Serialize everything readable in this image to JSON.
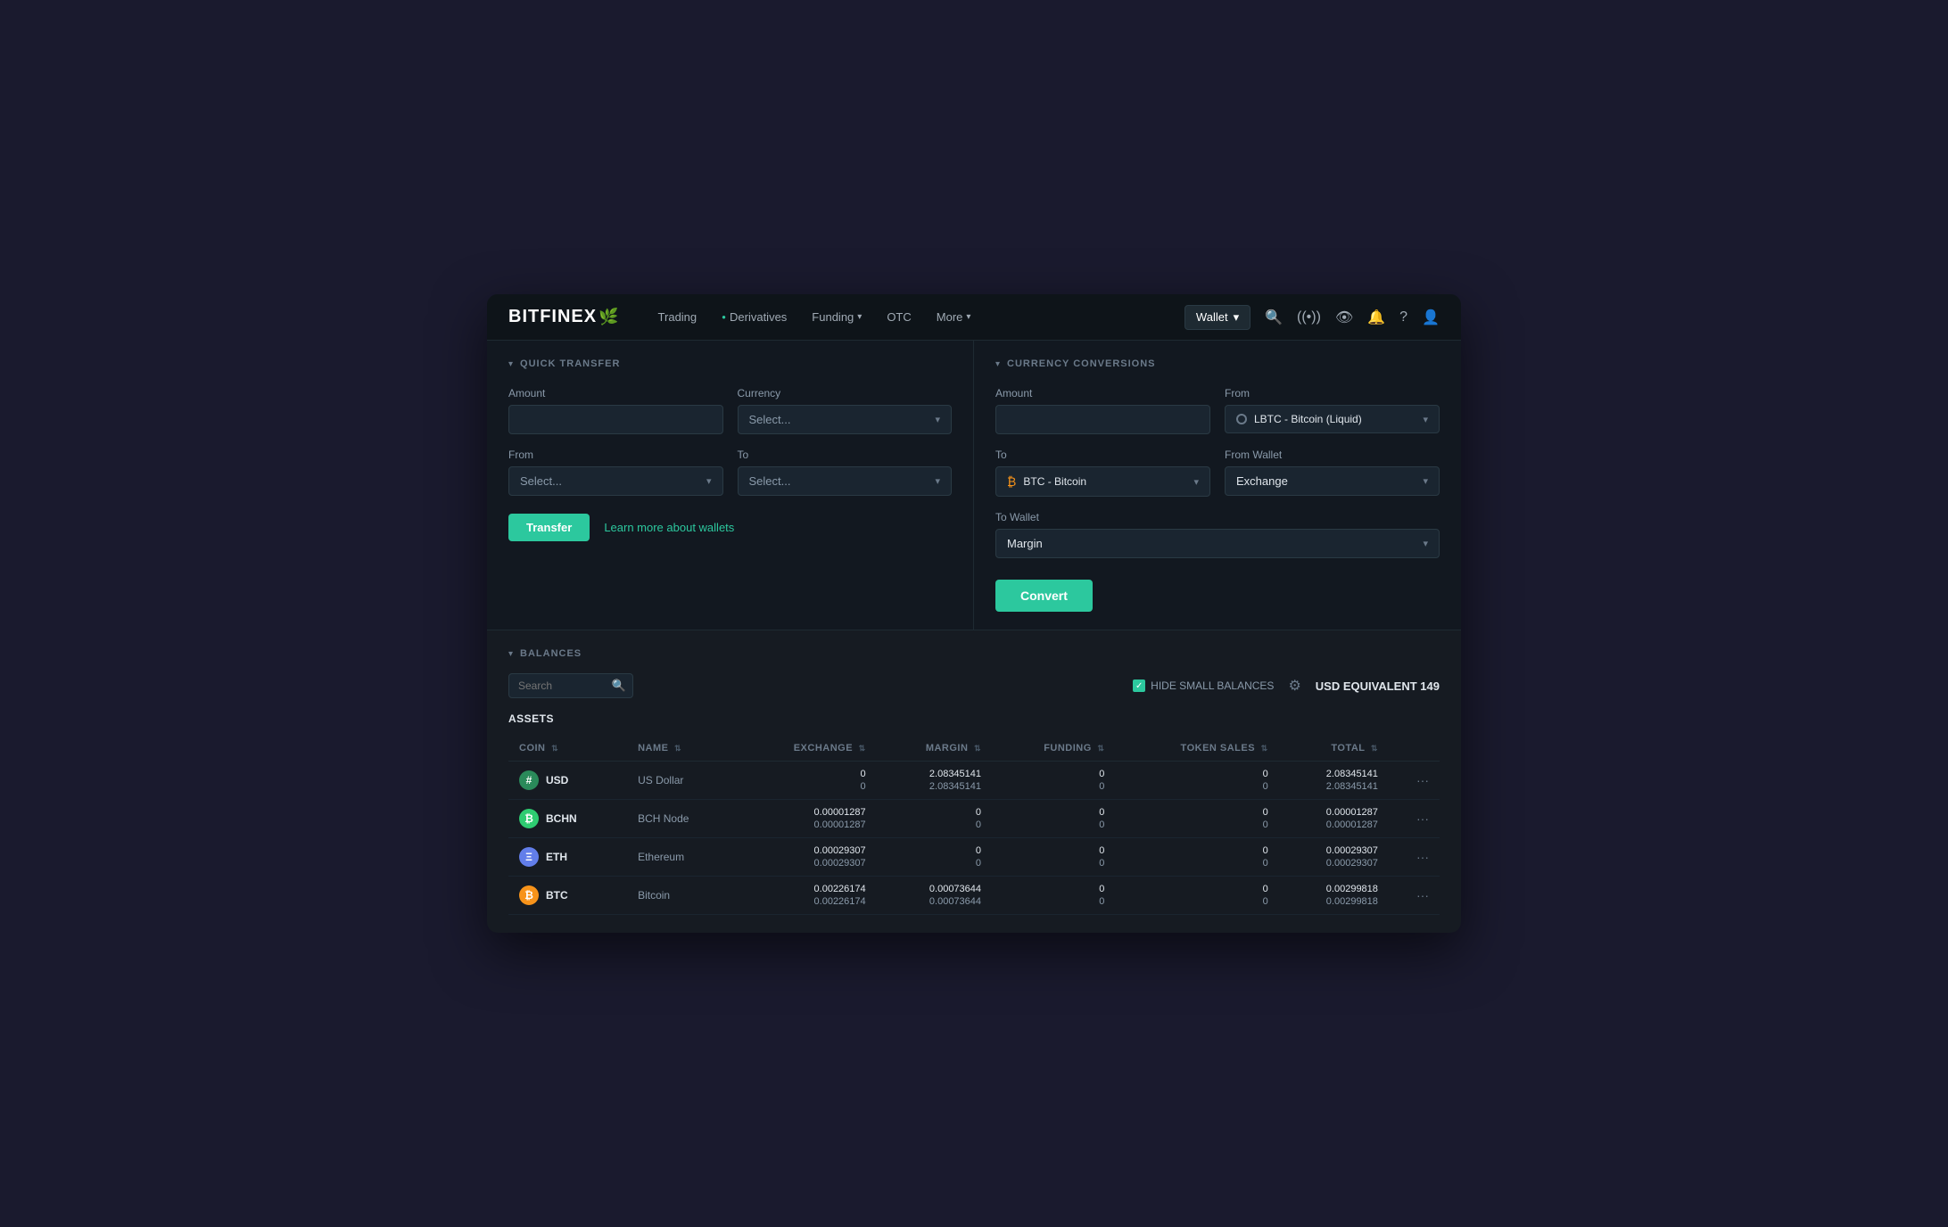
{
  "app": {
    "title": "BITFINEX"
  },
  "nav": {
    "items": [
      {
        "label": "Trading",
        "has_dot": false,
        "has_chevron": false
      },
      {
        "label": "Derivatives",
        "has_dot": true,
        "has_chevron": false
      },
      {
        "label": "Funding",
        "has_dot": false,
        "has_chevron": true
      },
      {
        "label": "OTC",
        "has_dot": false,
        "has_chevron": false
      },
      {
        "label": "More",
        "has_dot": false,
        "has_chevron": true
      }
    ],
    "wallet_label": "Wallet"
  },
  "quick_transfer": {
    "section_title": "QUICK TRANSFER",
    "amount_label": "Amount",
    "amount_placeholder": "",
    "currency_label": "Currency",
    "currency_placeholder": "Select...",
    "from_label": "From",
    "from_placeholder": "Select...",
    "to_label": "To",
    "to_placeholder": "Select...",
    "transfer_button": "Transfer",
    "learn_more_link": "Learn more about wallets"
  },
  "currency_conversions": {
    "section_title": "CURRENCY CONVERSIONS",
    "amount_label": "Amount",
    "amount_placeholder": "",
    "from_label": "From",
    "from_value": "LBTC - Bitcoin (Liquid)",
    "to_label": "To",
    "to_value": "BTC - Bitcoin",
    "from_wallet_label": "From Wallet",
    "from_wallet_value": "Exchange",
    "to_wallet_label": "To Wallet",
    "to_wallet_value": "Margin",
    "convert_button": "Convert"
  },
  "balances": {
    "section_title": "BALANCES",
    "search_placeholder": "Search",
    "hide_small_label": "HIDE SMALL BALANCES",
    "usd_equiv_label": "USD EQUIVALENT",
    "usd_equiv_value": "149",
    "assets_label": "ASSETS",
    "columns": [
      {
        "label": "COIN",
        "sortable": true
      },
      {
        "label": "NAME",
        "sortable": true
      },
      {
        "label": "EXCHANGE",
        "sortable": true
      },
      {
        "label": "MARGIN",
        "sortable": true
      },
      {
        "label": "FUNDING",
        "sortable": true
      },
      {
        "label": "TOKEN SALES",
        "sortable": true
      },
      {
        "label": "TOTAL",
        "sortable": true
      },
      {
        "label": ""
      }
    ],
    "rows": [
      {
        "coin": "USD",
        "icon_type": "usd",
        "icon_symbol": "$",
        "name": "US Dollar",
        "exchange": [
          "0",
          "0"
        ],
        "margin": [
          "2.08345141",
          "2.08345141"
        ],
        "funding": [
          "0",
          "0"
        ],
        "token_sales": [
          "0",
          "0"
        ],
        "total": [
          "2.08345141",
          "2.08345141"
        ]
      },
      {
        "coin": "BCHN",
        "icon_type": "bchn",
        "icon_symbol": "₿",
        "name": "BCH Node",
        "exchange": [
          "0.00001287",
          "0.00001287"
        ],
        "margin": [
          "0",
          "0"
        ],
        "funding": [
          "0",
          "0"
        ],
        "token_sales": [
          "0",
          "0"
        ],
        "total": [
          "0.00001287",
          "0.00001287"
        ]
      },
      {
        "coin": "ETH",
        "icon_type": "eth",
        "icon_symbol": "Ξ",
        "name": "Ethereum",
        "exchange": [
          "0.00029307",
          "0.00029307"
        ],
        "margin": [
          "0",
          "0"
        ],
        "funding": [
          "0",
          "0"
        ],
        "token_sales": [
          "0",
          "0"
        ],
        "total": [
          "0.00029307",
          "0.00029307"
        ]
      },
      {
        "coin": "BTC",
        "icon_type": "btc",
        "icon_symbol": "₿",
        "name": "Bitcoin",
        "exchange": [
          "0.00226174",
          "0.00226174"
        ],
        "margin": [
          "0.00073644",
          "0.00073644"
        ],
        "funding": [
          "0",
          "0"
        ],
        "token_sales": [
          "0",
          "0"
        ],
        "total": [
          "0.00299818",
          "0.00299818"
        ]
      }
    ]
  }
}
